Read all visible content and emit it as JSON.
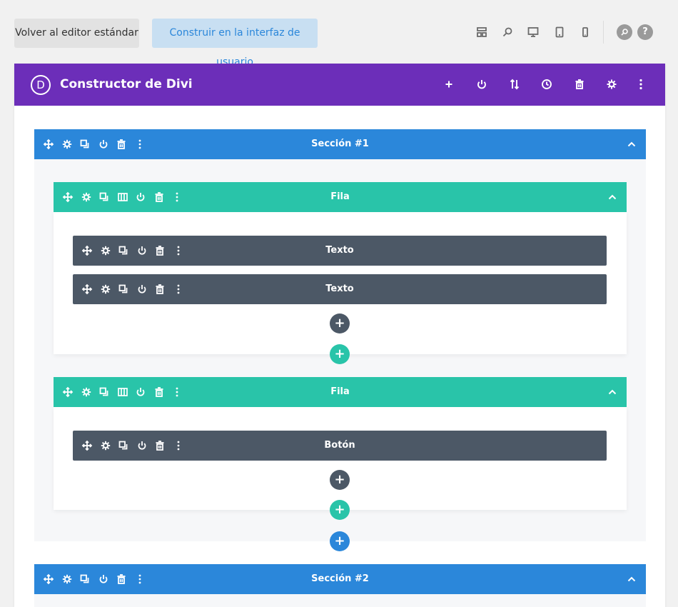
{
  "toolbar": {
    "back_label": "Volver al editor estándar",
    "visual_label": "Construir en la interfaz de usuario",
    "icons": [
      "wireframe-icon",
      "zoom-icon",
      "desktop-icon",
      "tablet-icon",
      "phone-icon",
      "search-icon",
      "help-icon"
    ],
    "help_label": "?"
  },
  "builder": {
    "logo_letter": "D",
    "title": "Constructor de Divi",
    "header_icons": [
      "add-icon",
      "power-icon",
      "sort-icon",
      "history-icon",
      "trash-icon",
      "gear-icon",
      "more-icon"
    ]
  },
  "sections": [
    {
      "label": "Sección #1",
      "rows": [
        {
          "label": "Fila",
          "modules": [
            {
              "label": "Texto"
            },
            {
              "label": "Texto"
            }
          ]
        },
        {
          "label": "Fila",
          "modules": [
            {
              "label": "Botón"
            }
          ]
        }
      ]
    },
    {
      "label": "Sección #2",
      "rows": []
    }
  ],
  "add_symbol": "+",
  "colors": {
    "purple": "#6c2eb9",
    "section_blue": "#2b87da",
    "row_teal": "#29c4a9",
    "module_gray": "#4c5866"
  }
}
